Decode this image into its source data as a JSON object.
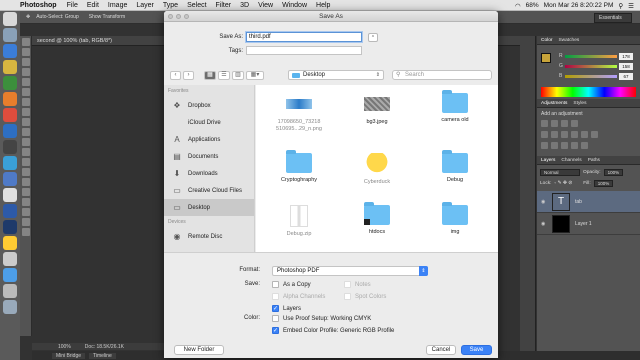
{
  "menubar": {
    "app": "Photoshop",
    "items": [
      "File",
      "Edit",
      "Image",
      "Layer",
      "Type",
      "Select",
      "Filter",
      "3D",
      "View",
      "Window",
      "Help"
    ],
    "battery": "68%",
    "clock": "Mon Mar 26  8:20:22 PM"
  },
  "ps": {
    "options_text": "Auto-Select:  Group",
    "show_transform": "Show Transform",
    "workspace": "Essentials",
    "doc_tab": "second @ 100% (tab, RGB/8*)",
    "zoom": "100%",
    "doc_size": "Doc: 18.5K/26.1K",
    "bottom_tabs": [
      "Mini Bridge",
      "Timeline"
    ],
    "panels": {
      "color_tabs": [
        "Color",
        "Swatches"
      ],
      "rgb": [
        {
          "label": "R",
          "value": "178"
        },
        {
          "label": "G",
          "value": "158"
        },
        {
          "label": "B",
          "value": "67"
        }
      ],
      "adj_tabs": [
        "Adjustments",
        "Styles"
      ],
      "adj_title": "Add an adjustment",
      "layers_tabs": [
        "Layers",
        "Channels",
        "Paths"
      ],
      "blend_mode": "Normal",
      "opacity_label": "Opacity:",
      "opacity": "100%",
      "lock_label": "Lock:",
      "fill_label": "Fill:",
      "fill": "100%",
      "layers": [
        {
          "name": "tab",
          "thumb": "T",
          "selected": true
        },
        {
          "name": "Layer 1",
          "thumb": "",
          "selected": false
        }
      ]
    }
  },
  "dialog": {
    "title": "Save As",
    "save_as_label": "Save As:",
    "filename": "third.pdf",
    "tags_label": "Tags:",
    "location": "Desktop",
    "search_placeholder": "Search",
    "sidebar": {
      "favorites_header": "Favorites",
      "favorites": [
        {
          "label": "Dropbox",
          "icon": "dropbox-icon",
          "glyph": "❖"
        },
        {
          "label": "iCloud Drive",
          "icon": "icloud-icon",
          "glyph": ""
        },
        {
          "label": "Applications",
          "icon": "applications-icon",
          "glyph": "A"
        },
        {
          "label": "Documents",
          "icon": "documents-icon",
          "glyph": "▤"
        },
        {
          "label": "Downloads",
          "icon": "downloads-icon",
          "glyph": "⬇"
        },
        {
          "label": "Creative Cloud Files",
          "icon": "folder-icon",
          "glyph": "▭"
        },
        {
          "label": "Desktop",
          "icon": "desktop-icon",
          "glyph": "▭",
          "selected": true
        }
      ],
      "devices_header": "Devices",
      "devices": [
        {
          "label": "Remote Disc",
          "icon": "remote-disc-icon",
          "glyph": "◉"
        }
      ]
    },
    "files": [
      {
        "name": "17098650_73218 510695...29_n.png",
        "kind": "image-blue",
        "dim": true
      },
      {
        "name": "bg3.jpeg",
        "kind": "image-grey",
        "dim": false
      },
      {
        "name": "camera old",
        "kind": "folder",
        "dim": false
      },
      {
        "name": "Cryptoghraphy",
        "kind": "folder",
        "dim": false
      },
      {
        "name": "Cyberduck",
        "kind": "app-duck",
        "dim": true
      },
      {
        "name": "Debug",
        "kind": "folder",
        "dim": false
      },
      {
        "name": "Debug.zip",
        "kind": "zip",
        "dim": true
      },
      {
        "name": "htdocs",
        "kind": "folder-dark",
        "dim": false
      },
      {
        "name": "img",
        "kind": "folder",
        "dim": false
      }
    ],
    "format_label": "Format:",
    "format": "Photoshop PDF",
    "save_label": "Save:",
    "save_options": [
      {
        "label": "As a Copy",
        "checked": false,
        "enabled": true
      },
      {
        "label": "Notes",
        "checked": false,
        "enabled": false
      },
      {
        "label": "Alpha Channels",
        "checked": false,
        "enabled": false
      },
      {
        "label": "Spot Colors",
        "checked": false,
        "enabled": false
      },
      {
        "label": "Layers",
        "checked": true,
        "enabled": true
      }
    ],
    "color_label": "Color:",
    "color_options": [
      {
        "label": "Use Proof Setup:  Working CMYK",
        "checked": false
      },
      {
        "label": "Embed Color Profile:  Generic RGB Profile",
        "checked": true
      }
    ],
    "new_folder": "New Folder",
    "cancel": "Cancel",
    "save": "Save"
  },
  "colors": {
    "accent": "#3b82f6",
    "folder": "#6cc0f4",
    "fg_swatch": "#c8a43a"
  }
}
